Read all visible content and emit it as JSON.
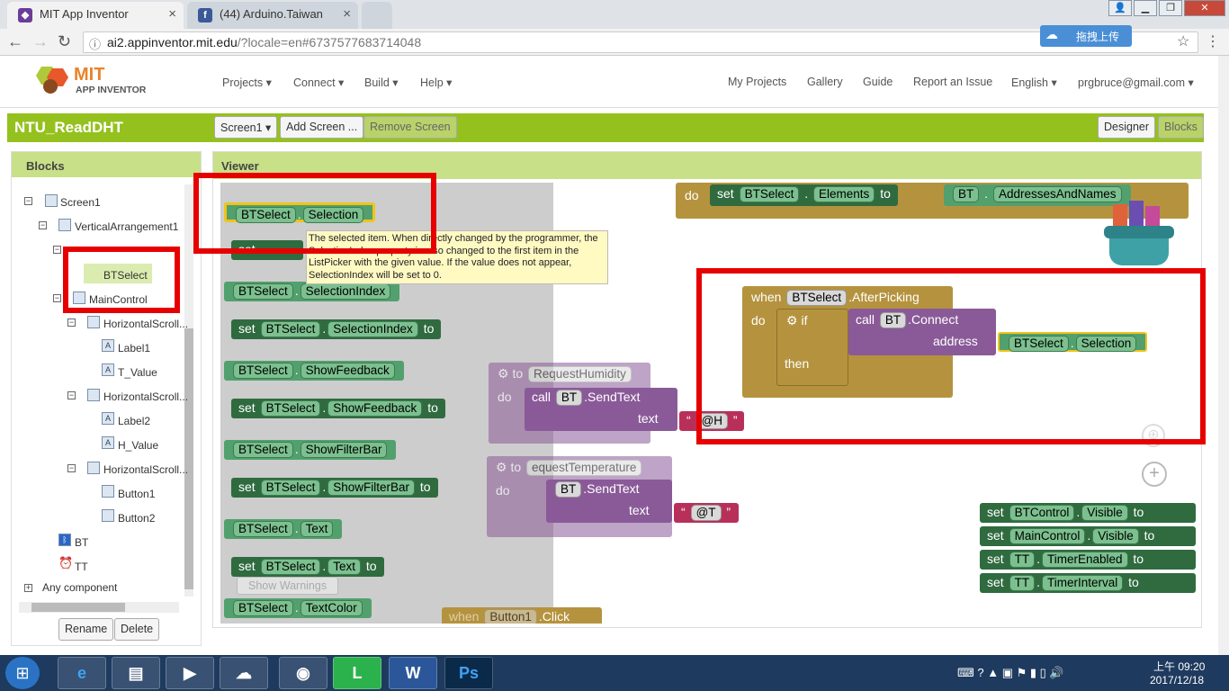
{
  "browser": {
    "tabs": [
      {
        "title": "MIT App Inventor",
        "active": true
      },
      {
        "title": "(44) Arduino.Taiwan",
        "active": false
      }
    ],
    "url_host": "ai2.appinventor.mit.edu",
    "url_path": "/?locale=en#6737577683714048",
    "ext_button": "拖拽上传"
  },
  "app": {
    "logo_top": "MIT",
    "logo_bottom": "APP INVENTOR",
    "menu": [
      "Projects ▾",
      "Connect ▾",
      "Build ▾",
      "Help ▾"
    ],
    "right_links": [
      "My Projects",
      "Gallery",
      "Guide",
      "Report an Issue",
      "English ▾",
      "prgbruce@gmail.com ▾"
    ]
  },
  "project": {
    "name": "NTU_ReadDHT",
    "screen_button": "Screen1 ▾",
    "add_screen": "Add Screen ...",
    "remove_screen": "Remove Screen",
    "designer": "Designer",
    "blocks": "Blocks"
  },
  "blocks_panel": {
    "title": "Blocks",
    "tree": {
      "screen1": "Screen1",
      "vertical": "VerticalArrangement1",
      "btselect": "BTSelect",
      "maincontrol": "MainControl",
      "hs1": "HorizontalScroll...",
      "label1": "Label1",
      "tvalue": "T_Value",
      "hs2": "HorizontalScroll...",
      "label2": "Label2",
      "hvalue": "H_Value",
      "hs3": "HorizontalScroll...",
      "button1": "Button1",
      "button2": "Button2",
      "bt": "BT",
      "tt": "TT",
      "any": "Any component"
    },
    "rename": "Rename",
    "delete": "Delete"
  },
  "viewer": {
    "title": "Viewer",
    "kw": {
      "set": "set",
      "to": "to",
      "do": "do",
      "when": "when",
      "call": "call",
      "if": "if",
      "then": "then",
      "text": "text",
      "address": "address",
      "dot": ".",
      "quote": "“",
      "quote_end": "”"
    },
    "comp": {
      "btselect": "BTSelect",
      "bt": "BT",
      "btcontrol": "BTControl",
      "maincontrol": "MainControl",
      "tt": "TT",
      "button1": "Button1"
    },
    "props": {
      "selection": "Selection",
      "selectionindex": "SelectionIndex",
      "showfeedback": "ShowFeedback",
      "showfilterbar": "ShowFilterBar",
      "text": "Text",
      "textcolor": "TextColor",
      "elements": "Elements",
      "addresses": "AddressesAndNames",
      "visible": "Visible",
      "timerenabled": "TimerEnabled",
      "timerinterval": "TimerInterval"
    },
    "events": {
      "afterpicking": ".AfterPicking",
      "connect": ".Connect",
      "sendtext": ".SendText",
      "click": ".Click"
    },
    "procs": {
      "humidity": "RequestHumidity",
      "temperature": "equestTemperature"
    },
    "strings": {
      "h": "@H",
      "t": "@T"
    },
    "show_warnings": "Show Warnings",
    "tooltip": "The selected item. When directly changed by the programmer, the SelectionIndex property is also changed to the first item in the ListPicker with the given value. If the value does not appear, SelectionIndex will be set to 0."
  },
  "taskbar": {
    "time": "上午 09:20",
    "date": "2017/12/18"
  }
}
